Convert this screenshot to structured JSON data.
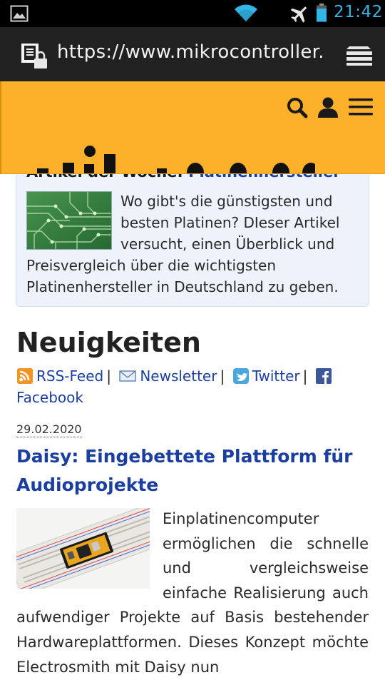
{
  "status_bar": {
    "time": "21:42",
    "icons": [
      "gallery-icon",
      "wifi-icon",
      "airplane-mode-icon",
      "battery-icon"
    ],
    "clock_color": "#33b5e5"
  },
  "browser": {
    "url": "https://www.mikrocontroller.ne",
    "icons": [
      "site-lock-icon",
      "tabs-icon"
    ]
  },
  "site_header": {
    "background": "#fdb12a",
    "icons": [
      "search-icon",
      "user-icon",
      "hamburger-menu-icon"
    ]
  },
  "featured": {
    "title_prefix": "Artikel der Woche:",
    "title_link": "Platinenhersteller",
    "text": "Wo gibt's die günstigsten und besten Platinen? DIeser Artikel versucht, einen Überblick und Preisvergleich über die wichtigsten Platinenhersteller in Deutschland zu geben."
  },
  "news": {
    "heading": "Neuigkeiten",
    "feeds": [
      {
        "label": "RSS-Feed",
        "icon": "rss-icon"
      },
      {
        "label": "Newsletter",
        "icon": "mail-icon"
      },
      {
        "label": "Twitter",
        "icon": "twitter-icon"
      },
      {
        "label": "Facebook",
        "icon": "facebook-icon"
      }
    ],
    "separator": "|",
    "post": {
      "date": "29.02.2020",
      "title": "Daisy: Eingebettete Plattform für Audioprojekte",
      "body": "Einplatinencomputer ermöglichen die schnelle und vergleichsweise einfache Realisierung auch aufwendiger Projekte auf Basis bestehender Hardwareplattformen. Dieses Konzept möchte Electrosmith mit Daisy nun"
    }
  },
  "colors": {
    "link": "#1a3fa0",
    "header_orange": "#fdb12a",
    "feature_bg": "#eef3fb"
  }
}
